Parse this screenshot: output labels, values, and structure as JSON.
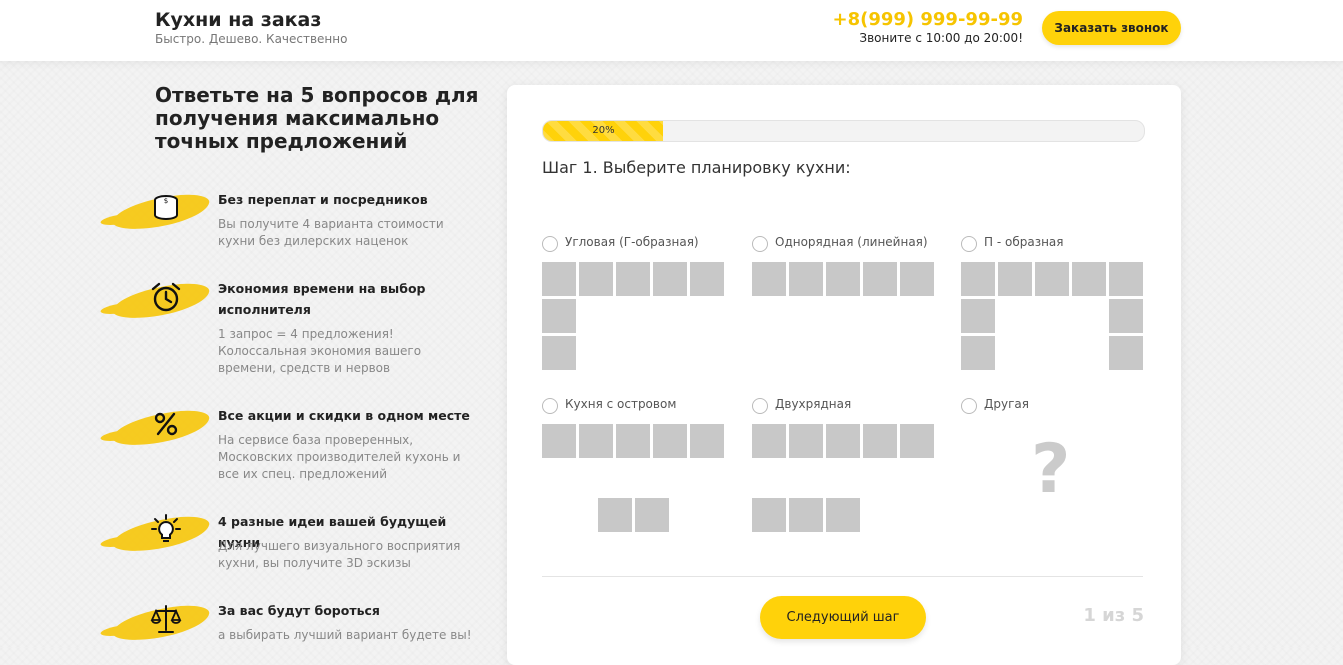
{
  "header": {
    "brand_title": "Кухни на заказ",
    "brand_subtitle": "Быстро. Дешево. Качественно",
    "phone": "+8(999) 999-99-99",
    "hours": "Звоните с 10:00 до 20:00!",
    "call_button": "Заказать звонок"
  },
  "left": {
    "title": "Ответьте на 5 вопросов для получения максимально точных предложений",
    "benefits": [
      {
        "icon": "coins-icon",
        "title": "Без переплат и посредников",
        "text": "Вы получите 4 варианта стоимости кухни без дилерских наценок"
      },
      {
        "icon": "alarm-clock-icon",
        "title": "Экономия времени на выбор исполнителя",
        "text": "1 запрос = 4 предложения! Колоссальная экономия вашего времени, средств и нервов"
      },
      {
        "icon": "percent-icon",
        "title": "Все акции и скидки в одном месте",
        "text": "На сервисе база проверенных, Московских производителей кухонь и все их спец. предложений"
      },
      {
        "icon": "lightbulb-icon",
        "title": "4 разные идеи вашей будущей кухни",
        "text": "Для лучшего визуального восприятия кухни, вы получите 3D эскизы"
      },
      {
        "icon": "scales-icon",
        "title": "За вас будут бороться",
        "text": "а выбирать лучший вариант будете вы!"
      }
    ]
  },
  "quiz": {
    "progress_percent": 20,
    "progress_label": "20%",
    "step_title": "Шаг 1. Выберите планировку кухни:",
    "options": [
      {
        "label": "Угловая (Г-образная)"
      },
      {
        "label": "Однорядная (линейная)"
      },
      {
        "label": "П - образная"
      },
      {
        "label": "Кухня с островом"
      },
      {
        "label": "Двухрядная"
      },
      {
        "label": "Другая"
      }
    ],
    "other_symbol": "?",
    "next_button": "Следующий шаг",
    "step_counter": "1 из 5"
  },
  "colors": {
    "accent": "#ffd20a",
    "phone": "#f6c400",
    "cell": "#c8c8c8"
  }
}
